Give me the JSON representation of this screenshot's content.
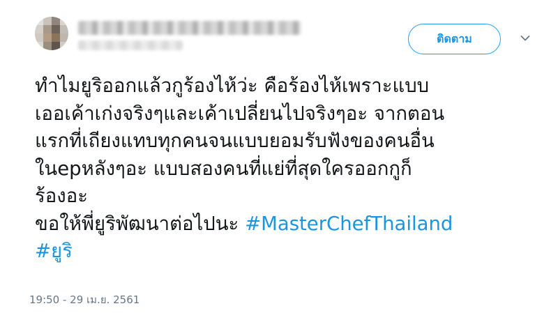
{
  "header": {
    "follow_label": "ติดตาม",
    "more_icon": "chevron-down-icon"
  },
  "tweet": {
    "lines": [
      "ทำไมยูริออกแล้วกูร้องไห้ว่ะ คือร้องไห้เพราะแบบ",
      "เออเค้าเก่งจริงๆและเค้าเปลี่ยนไปจริงๆอะ จากตอน",
      "แรกที่เถียงแทบทุกคนจนแบบยอมรับฟังของคนอื่น",
      "ในepหลังๆอะ  แบบสองคนที่แย่ที่สุดใครออกกูก็",
      "ร้องอะ"
    ],
    "last_line_text": "ขอให้พี่ยูริพัฒนาต่อไปนะ ",
    "hashtags": [
      "#MasterChefThailand",
      "#ยูริ"
    ],
    "timestamp": "19:50 - 29 เม.ย. 2561"
  },
  "colors": {
    "link": "#1b95e0",
    "text": "#14171a",
    "muted": "#657786"
  }
}
